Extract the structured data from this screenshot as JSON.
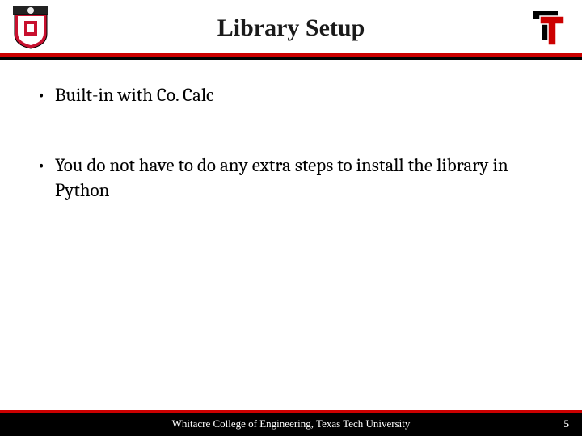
{
  "header": {
    "title": "Library Setup"
  },
  "bullets": {
    "b1": "Built-in with Co. Calc",
    "b2": "You do not have to do any extra steps to install the library in Python"
  },
  "footer": {
    "text": "Whitacre College of Engineering, Texas Tech University",
    "page": "5"
  }
}
